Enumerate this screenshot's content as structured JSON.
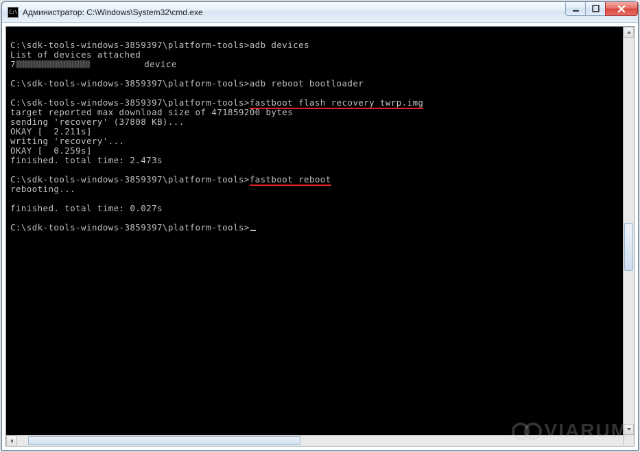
{
  "window": {
    "title": "Администратор: C:\\Windows\\System32\\cmd.exe"
  },
  "prompt": "C:\\sdk-tools-windows-3859397\\platform-tools>",
  "cmd": {
    "adb_devices": "adb devices",
    "list_header": "List of devices attached",
    "device_serial_prefix": "7",
    "device_state": "device",
    "adb_reboot": "adb reboot bootloader",
    "fb_flash": "fastboot flash recovery twrp.img",
    "fb_reboot": "fastboot reboot"
  },
  "out": {
    "target_line": "target reported max download size of 471859200 bytes",
    "sending": "sending 'recovery' (37808 KB)...",
    "okay1": "OKAY [  2.211s]",
    "writing": "writing 'recovery'...",
    "okay2": "OKAY [  0.259s]",
    "finished1": "finished. total time: 2.473s",
    "rebooting": "rebooting...",
    "finished2": "finished. total time: 0.027s"
  },
  "watermark": "VIARUM"
}
